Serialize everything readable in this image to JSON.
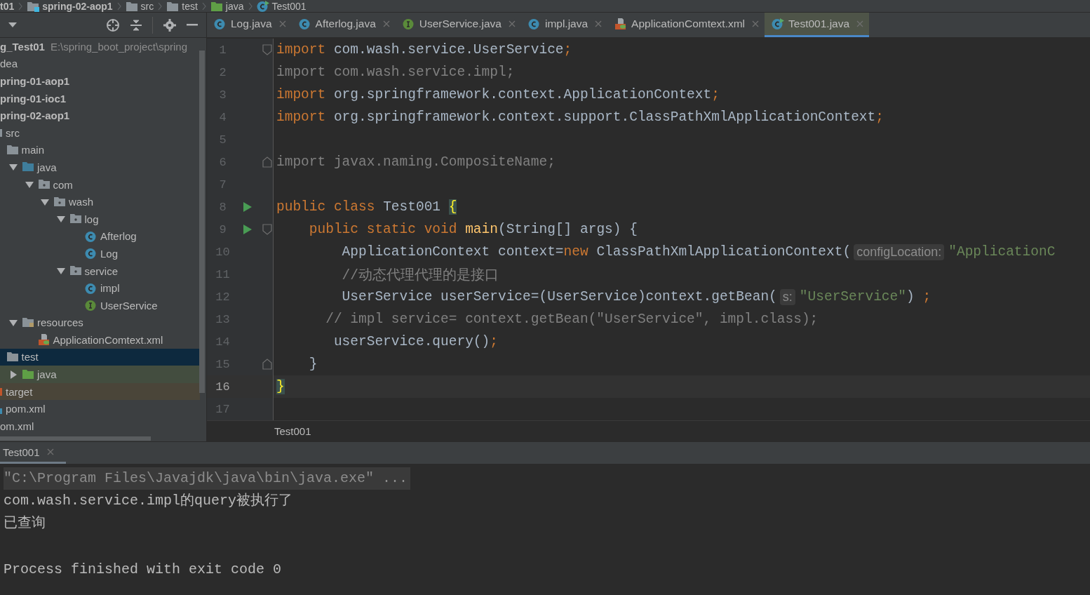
{
  "breadcrumbs": [
    {
      "label": "t01",
      "kind": "none",
      "bold": true
    },
    {
      "label": "spring-02-aop1",
      "kind": "module",
      "bold": true
    },
    {
      "label": "src",
      "kind": "folder",
      "bold": false
    },
    {
      "label": "test",
      "kind": "folder",
      "bold": false
    },
    {
      "label": "java",
      "kind": "test-source",
      "bold": false
    },
    {
      "label": "Test001",
      "kind": "class-run",
      "bold": false
    }
  ],
  "project_tree": [
    {
      "label": "g_Test01",
      "path": "E:\\spring_boot_project\\spring",
      "bold": true,
      "selected": false,
      "children": [
        {
          "label": "dea",
          "bold": false,
          "selected": false
        },
        {
          "label": "pring-01-aop1",
          "bold": true,
          "selected": false
        },
        {
          "label": "pring-01-ioc1",
          "bold": true,
          "selected": false
        },
        {
          "label": "pring-02-aop1",
          "bold": true,
          "selected": false,
          "children": [
            {
              "label": "src",
              "kind": "folder",
              "bold": false,
              "selected": false,
              "children": [
                {
                  "label": "main",
                  "kind": "folder",
                  "bold": false,
                  "selected": false,
                  "children": [
                    {
                      "label": "java",
                      "kind": "source",
                      "bold": false,
                      "selected": false,
                      "expanded": true,
                      "children": [
                        {
                          "label": "com",
                          "kind": "package",
                          "bold": false,
                          "selected": false,
                          "expanded": true,
                          "children": [
                            {
                              "label": "wash",
                              "kind": "package",
                              "bold": false,
                              "selected": false,
                              "expanded": true,
                              "children": [
                                {
                                  "label": "log",
                                  "kind": "package",
                                  "bold": false,
                                  "selected": false,
                                  "expanded": true,
                                  "children": [
                                    {
                                      "label": "Afterlog",
                                      "kind": "class",
                                      "bold": false,
                                      "selected": false
                                    },
                                    {
                                      "label": "Log",
                                      "kind": "class",
                                      "bold": false,
                                      "selected": false
                                    }
                                  ]
                                },
                                {
                                  "label": "service",
                                  "kind": "package",
                                  "bold": false,
                                  "selected": false,
                                  "expanded": true,
                                  "children": [
                                    {
                                      "label": "impl",
                                      "kind": "class",
                                      "bold": false,
                                      "selected": false
                                    },
                                    {
                                      "label": "UserService",
                                      "kind": "interface",
                                      "bold": false,
                                      "selected": false
                                    }
                                  ]
                                }
                              ]
                            }
                          ]
                        }
                      ]
                    },
                    {
                      "label": "resources",
                      "kind": "resources",
                      "bold": false,
                      "selected": false,
                      "expanded": true,
                      "children": [
                        {
                          "label": "ApplicationComtext.xml",
                          "kind": "xml",
                          "bold": false,
                          "selected": false
                        }
                      ]
                    }
                  ]
                },
                {
                  "label": "test",
                  "kind": "folder",
                  "bold": false,
                  "selected": true,
                  "children": [
                    {
                      "label": "java",
                      "kind": "test-source",
                      "bold": false,
                      "selected": false,
                      "expanded": false
                    }
                  ]
                }
              ]
            },
            {
              "label": "target",
              "kind": "excluded",
              "bold": false,
              "selected": false
            },
            {
              "label": "pom.xml",
              "kind": "maven",
              "bold": false,
              "selected": false
            }
          ]
        },
        {
          "label": "om.xml",
          "bold": false,
          "selected": false
        }
      ]
    }
  ],
  "editor_tabs": [
    {
      "label": "Log.java",
      "kind": "class",
      "selected": false
    },
    {
      "label": "Afterlog.java",
      "kind": "class",
      "selected": false
    },
    {
      "label": "UserService.java",
      "kind": "interface",
      "selected": false
    },
    {
      "label": "impl.java",
      "kind": "class",
      "selected": false
    },
    {
      "label": "ApplicationComtext.xml",
      "kind": "xml",
      "selected": false
    },
    {
      "label": "Test001.java",
      "kind": "class-run",
      "selected": true
    }
  ],
  "code_lines": [
    {
      "number": "1",
      "current": false,
      "run": false,
      "fold_start": true,
      "fold_end": false,
      "tokens": [
        {
          "kind": "keyword",
          "text": "import "
        },
        {
          "kind": "plain",
          "text": "com.wash.service.UserService"
        },
        {
          "kind": "keyword",
          "text": ";"
        }
      ]
    },
    {
      "number": "2",
      "current": false,
      "run": false,
      "fold_start": false,
      "fold_end": false,
      "tokens": [
        {
          "kind": "unused",
          "text": "import com.wash.service.impl;"
        }
      ]
    },
    {
      "number": "3",
      "current": false,
      "run": false,
      "fold_start": false,
      "fold_end": false,
      "tokens": [
        {
          "kind": "keyword",
          "text": "import "
        },
        {
          "kind": "plain",
          "text": "org.springframework.context.ApplicationContext"
        },
        {
          "kind": "keyword",
          "text": ";"
        }
      ]
    },
    {
      "number": "4",
      "current": false,
      "run": false,
      "fold_start": false,
      "fold_end": false,
      "tokens": [
        {
          "kind": "keyword",
          "text": "import "
        },
        {
          "kind": "plain",
          "text": "org.springframework.context.support.ClassPathXmlApplicationContext"
        },
        {
          "kind": "keyword",
          "text": ";"
        }
      ]
    },
    {
      "number": "5",
      "current": false,
      "run": false,
      "fold_start": false,
      "fold_end": false
    },
    {
      "number": "6",
      "current": false,
      "run": false,
      "fold_start": false,
      "fold_end": true,
      "tokens": [
        {
          "kind": "unused",
          "text": "import javax.naming.CompositeName;"
        }
      ]
    },
    {
      "number": "7",
      "current": false,
      "run": false,
      "fold_start": false,
      "fold_end": false
    },
    {
      "number": "8",
      "current": false,
      "run": true,
      "fold_start": false,
      "fold_end": false,
      "tokens": [
        {
          "kind": "keyword",
          "text": "public class "
        },
        {
          "kind": "plain",
          "text": "Test001 "
        },
        {
          "kind": "brace",
          "text": "{"
        }
      ]
    },
    {
      "number": "9",
      "current": false,
      "run": true,
      "fold_start": true,
      "fold_end": false,
      "tokens": [
        {
          "kind": "keyword",
          "text": "    public static void "
        },
        {
          "kind": "method",
          "text": "main"
        },
        {
          "kind": "plain",
          "text": "(String[] args) {"
        }
      ]
    },
    {
      "number": "10",
      "current": false,
      "run": false,
      "fold_start": false,
      "fold_end": false,
      "tokens": [
        {
          "kind": "plain",
          "text": "        ApplicationContext context="
        },
        {
          "kind": "keyword",
          "text": "new "
        },
        {
          "kind": "plain",
          "text": "ClassPathXmlApplicationContext("
        },
        {
          "kind": "hint",
          "text": "configLocation:"
        },
        {
          "kind": "string",
          "text": "\"ApplicationC"
        }
      ]
    },
    {
      "number": "11",
      "current": false,
      "run": false,
      "fold_start": false,
      "fold_end": false,
      "tokens": [
        {
          "kind": "comment",
          "text": "        //动态代理代理的是接口"
        }
      ]
    },
    {
      "number": "12",
      "current": false,
      "run": false,
      "fold_start": false,
      "fold_end": false,
      "tokens": [
        {
          "kind": "plain",
          "text": "        UserService userService=(UserService)context.getBean("
        },
        {
          "kind": "hint",
          "text": "s:"
        },
        {
          "kind": "string",
          "text": "\"UserService\""
        },
        {
          "kind": "plain",
          "text": ") "
        },
        {
          "kind": "keyword",
          "text": ";"
        }
      ]
    },
    {
      "number": "13",
      "current": false,
      "run": false,
      "fold_start": false,
      "fold_end": false,
      "tokens": [
        {
          "kind": "comment",
          "text": "      // impl service= context.getBean(\"UserService\", impl.class);"
        }
      ]
    },
    {
      "number": "14",
      "current": false,
      "run": false,
      "fold_start": false,
      "fold_end": false,
      "tokens": [
        {
          "kind": "plain",
          "text": "       userService.query()"
        },
        {
          "kind": "keyword",
          "text": ";"
        }
      ]
    },
    {
      "number": "15",
      "current": false,
      "run": false,
      "fold_start": false,
      "fold_end": true,
      "tokens": [
        {
          "kind": "plain",
          "text": "    }"
        }
      ]
    },
    {
      "number": "16",
      "current": true,
      "run": false,
      "fold_start": false,
      "fold_end": false,
      "tokens": [
        {
          "kind": "brace",
          "text": "}"
        }
      ]
    },
    {
      "number": "17",
      "current": false,
      "run": false,
      "fold_start": false,
      "fold_end": false
    }
  ],
  "editor_breadcrumb": "Test001",
  "run_tab": {
    "label": "Test001",
    "selected": true
  },
  "console": [
    {
      "kind": "command",
      "text": "\"C:\\Program Files\\Javajdk\\java\\bin\\java.exe\" ..."
    },
    {
      "kind": "output",
      "text": "com.wash.service.impl的query被执行了"
    },
    {
      "kind": "output",
      "text": "已查询"
    },
    {
      "kind": "exit",
      "text": "Process finished with exit code 0"
    }
  ]
}
